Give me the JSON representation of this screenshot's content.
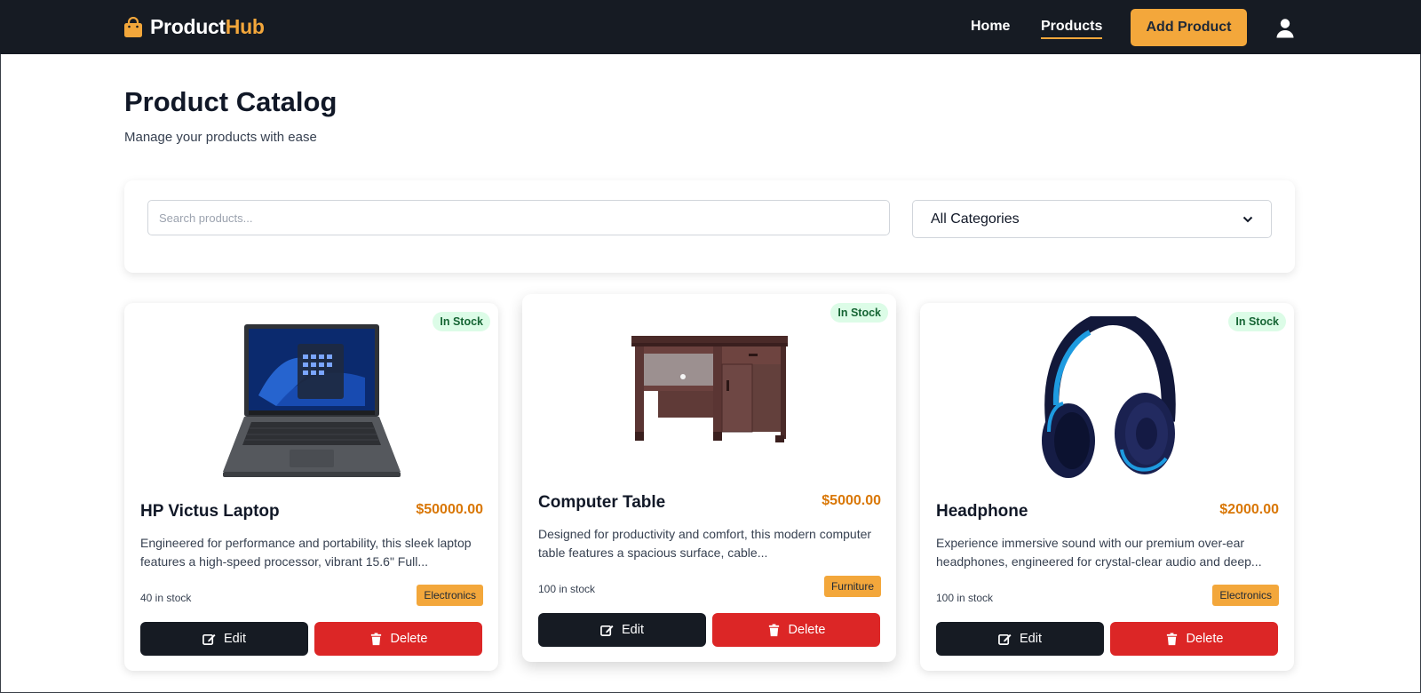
{
  "navbar": {
    "brand_main": "Product",
    "brand_accent": "Hub",
    "links": [
      {
        "label": "Home"
      },
      {
        "label": "Products"
      }
    ],
    "add_button": "Add Product",
    "icons": {
      "brand": "shopping-bag-icon",
      "user": "user-icon"
    }
  },
  "header": {
    "title": "Product Catalog",
    "subtitle": "Manage your products with ease"
  },
  "filters": {
    "search_placeholder": "Search products...",
    "category_selected": "All Categories"
  },
  "products": [
    {
      "name": "HP Victus Laptop",
      "price": "$50000.00",
      "description": "Engineered for performance and portability, this sleek laptop features a high-speed processor, vibrant 15.6\" Full...",
      "stock": "40 in stock",
      "status": "In Stock",
      "category": "Electronics",
      "image_icon": "laptop-image",
      "edit_label": "Edit",
      "delete_label": "Delete"
    },
    {
      "name": "Computer Table",
      "price": "$5000.00",
      "description": "Designed for productivity and comfort, this modern computer table features a spacious surface, cable...",
      "stock": "100 in stock",
      "status": "In Stock",
      "category": "Furniture",
      "image_icon": "desk-image",
      "edit_label": "Edit",
      "delete_label": "Delete"
    },
    {
      "name": "Headphone",
      "price": "$2000.00",
      "description": "Experience immersive sound with our premium over-ear headphones, engineered for crystal-clear audio and deep...",
      "stock": "100 in stock",
      "status": "In Stock",
      "category": "Electronics",
      "image_icon": "headphones-image",
      "edit_label": "Edit",
      "delete_label": "Delete"
    }
  ],
  "colors": {
    "navbar_bg": "#161b23",
    "accent": "#f3a73b",
    "price": "#d97706",
    "delete": "#dc2626",
    "stock_badge_bg": "#dcfce7",
    "stock_badge_text": "#166534"
  }
}
